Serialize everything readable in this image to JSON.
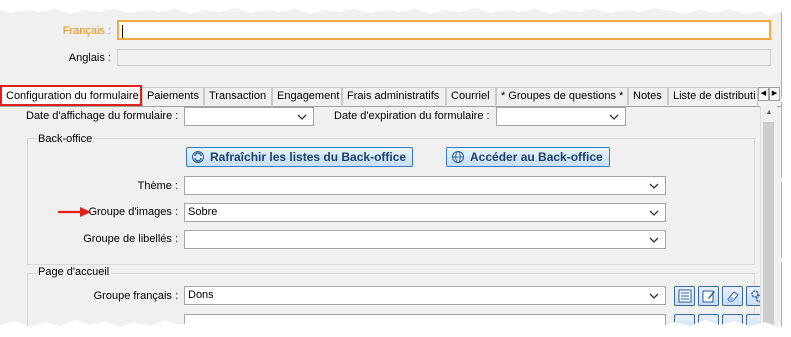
{
  "header": {
    "francais_label": "Français :",
    "anglais_label": "Anglais :"
  },
  "tabs": [
    {
      "label": "Configuration du formulaire",
      "active": true
    },
    {
      "label": "Paiements"
    },
    {
      "label": "Transaction"
    },
    {
      "label": "Engagement"
    },
    {
      "label": "Frais administratifs"
    },
    {
      "label": "Courriel"
    },
    {
      "label": "* Groupes de questions *"
    },
    {
      "label": "Notes"
    },
    {
      "label": "Liste de distributi"
    }
  ],
  "form": {
    "date_affichage_label": "Date d'affichage du formulaire :",
    "date_expiration_label": "Date d'expiration du formulaire :"
  },
  "backoffice": {
    "title": "Back-office",
    "refresh_button": "Rafraîchir les listes du Back-office",
    "access_button": "Accéder au Back-office",
    "theme_label": "Thème :",
    "theme_value": "",
    "groupe_images_label": "Groupe d'images :",
    "groupe_images_value": "Sobre",
    "groupe_libelles_label": "Groupe de libellés :",
    "groupe_libelles_value": ""
  },
  "page_accueil": {
    "title": "Page d'accueil",
    "groupe_francais_label": "Groupe français :",
    "groupe_francais_value": "Dons"
  },
  "colors": {
    "active_tab_border": "#e0201a",
    "annotation_arrow": "#e0201a",
    "focus_border": "#f4a940",
    "label_accent": "#e8901c",
    "button_text": "#1b3f6e"
  }
}
